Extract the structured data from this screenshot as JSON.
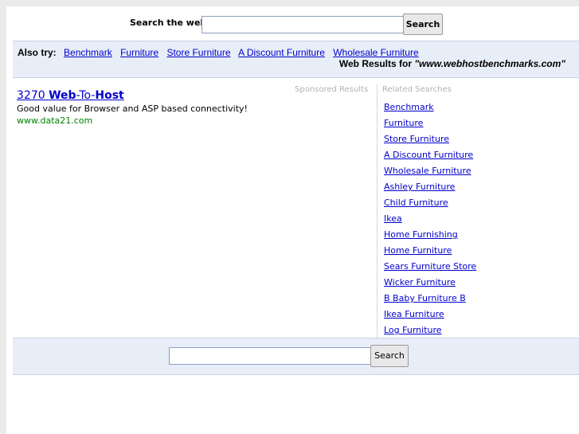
{
  "top_search": {
    "label": "Search the web:",
    "input_value": "",
    "button_label": "Search"
  },
  "also_try": {
    "title": "Also try:",
    "links": [
      "Benchmark",
      "Furniture",
      "Store Furniture",
      "A Discount Furniture",
      "Wholesale Furniture"
    ]
  },
  "web_results": {
    "prefix": "Web Results for",
    "query": "\"www.webhostbenchmarks.com\""
  },
  "sponsored": {
    "label": "Sponsored Results",
    "ads": [
      {
        "title_part1": "3270 ",
        "title_part2": "Web",
        "title_part3": "-To-",
        "title_part4": "Host",
        "description": "Good value for Browser and ASP based connectivity!",
        "url": "www.data21.com"
      }
    ]
  },
  "related": {
    "label": "Related Searches",
    "items": [
      "Benchmark",
      "Furniture",
      "Store Furniture",
      "A Discount Furniture",
      "Wholesale Furniture",
      "Ashley Furniture",
      "Child Furniture",
      "Ikea",
      "Home Furnishing",
      "Home Furniture",
      "Sears Furniture Store",
      "Wicker Furniture",
      "B Baby Furniture B",
      "Ikea Furniture",
      "Log Furniture"
    ]
  },
  "bottom_search": {
    "input_value": "",
    "button_label": "Search"
  }
}
